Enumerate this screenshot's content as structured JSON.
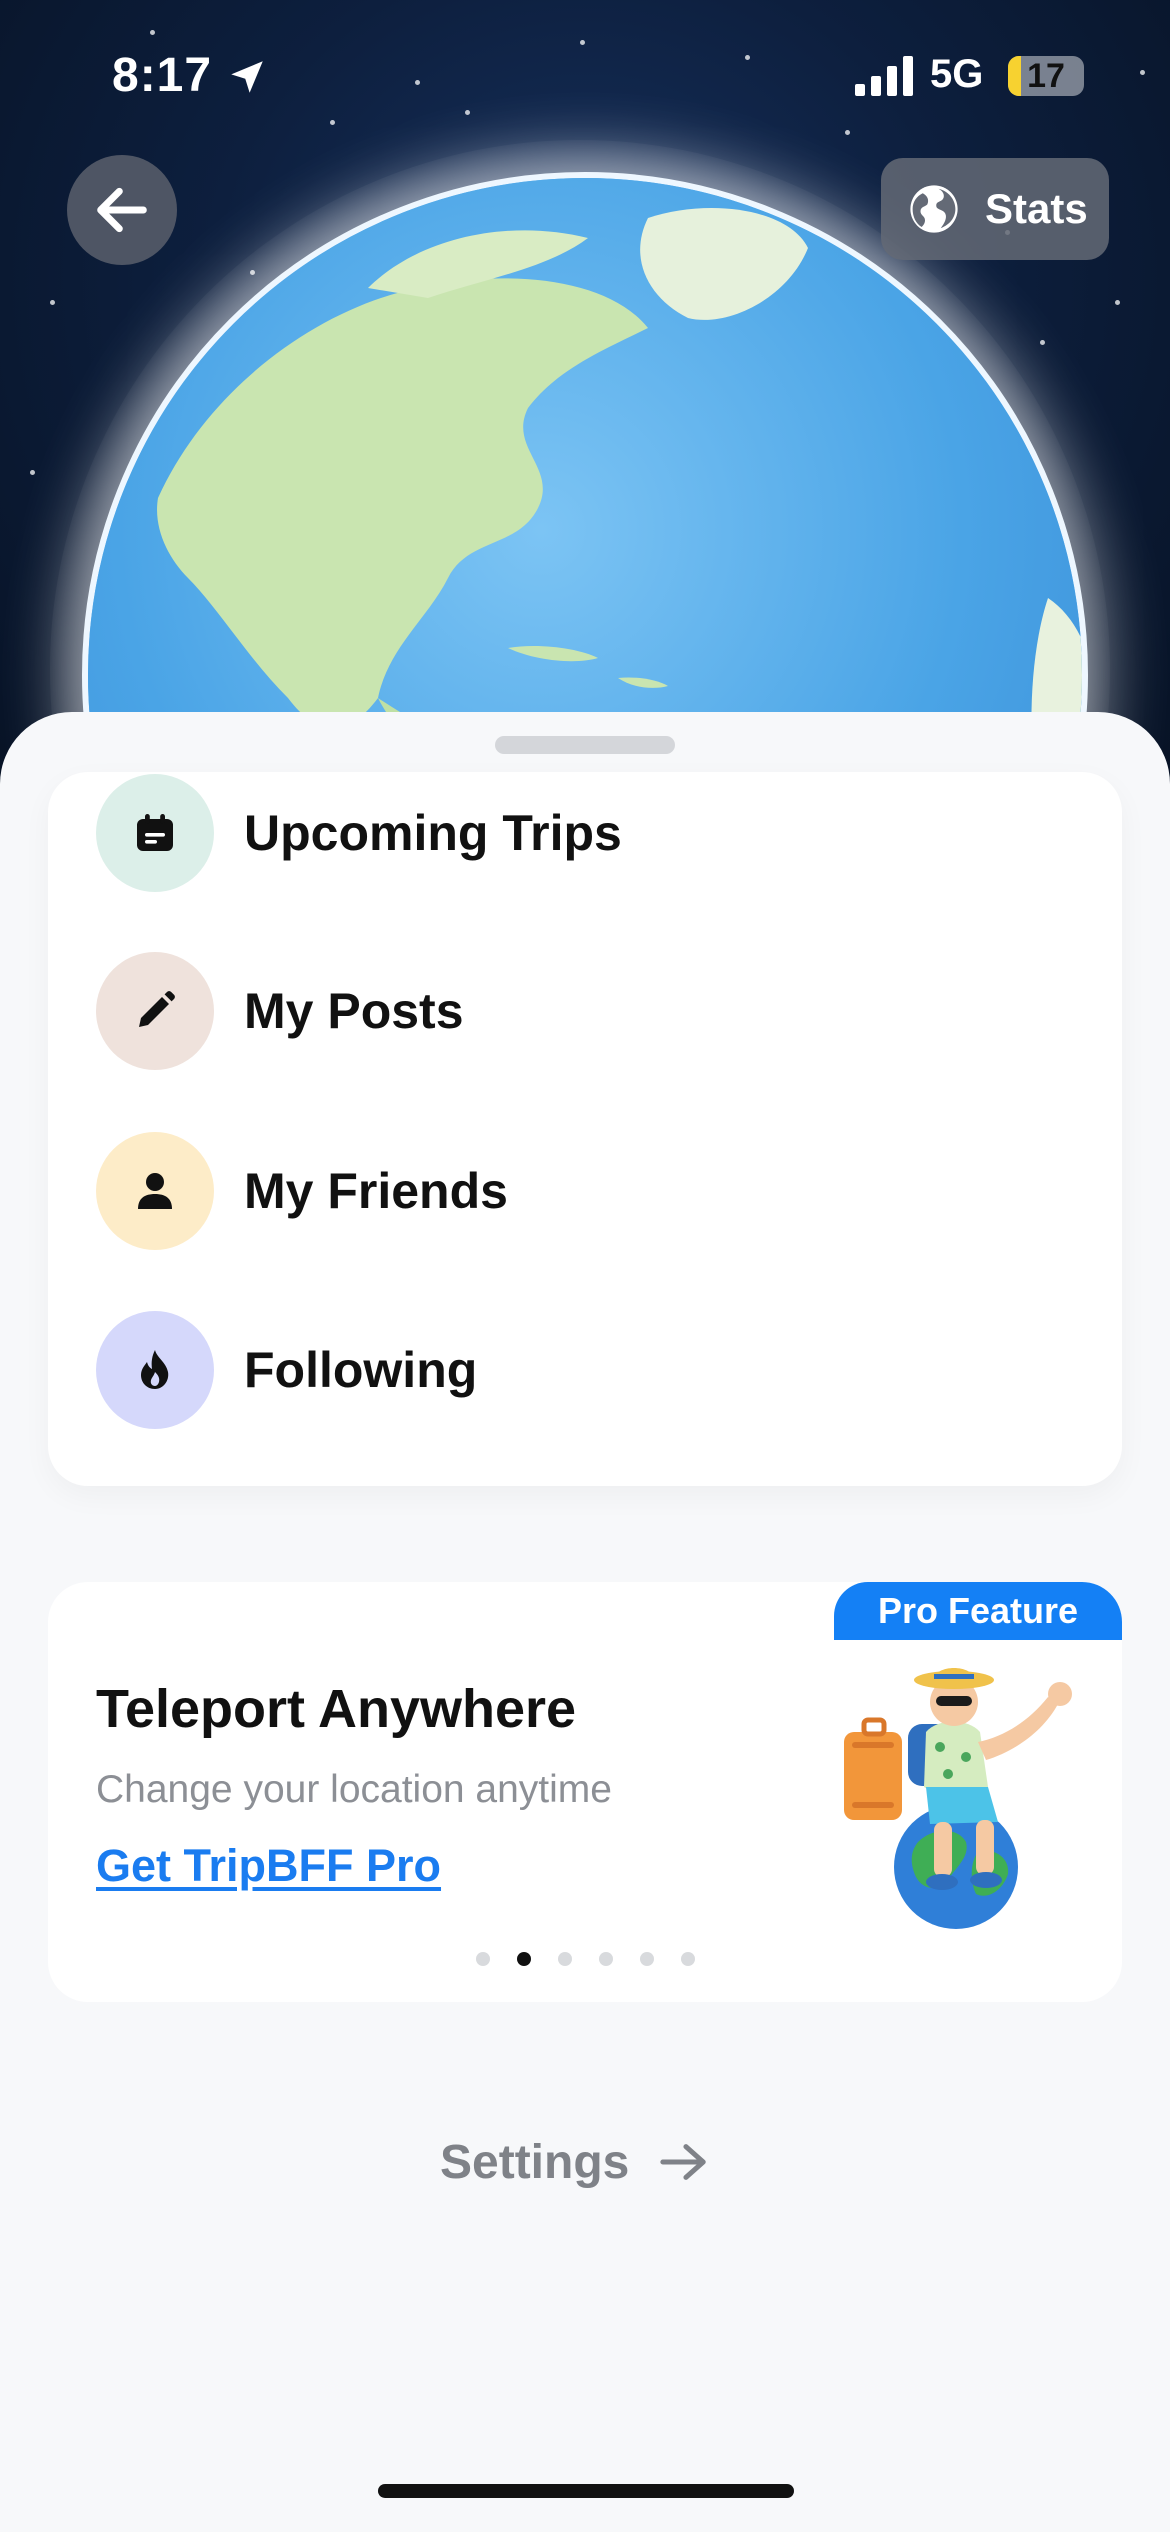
{
  "status_bar": {
    "time": "8:17",
    "network": "5G",
    "battery": "17",
    "battery_level_percent": 17
  },
  "header": {
    "back_icon": "arrow-left-icon",
    "stats_label": "Stats",
    "stats_icon": "globe-icon"
  },
  "menu": {
    "items": [
      {
        "label": "Upcoming Trips",
        "icon": "calendar-icon",
        "icon_bg": "#dcefe9"
      },
      {
        "label": "My Posts",
        "icon": "pencil-icon",
        "icon_bg": "#efe2dc"
      },
      {
        "label": "My Friends",
        "icon": "person-icon",
        "icon_bg": "#fdecc8"
      },
      {
        "label": "Following",
        "icon": "flame-icon",
        "icon_bg": "#d5d8fb"
      }
    ]
  },
  "promo": {
    "badge": "Pro Feature",
    "title": "Teleport Anywhere",
    "subtitle": "Change your location anytime",
    "link": "Get TripBFF Pro",
    "illustration": "traveler-on-globe-illustration",
    "carousel_pages": 6,
    "carousel_active_index": 1
  },
  "settings": {
    "label": "Settings",
    "icon": "arrow-right-icon"
  },
  "colors": {
    "accent_blue": "#1480f5",
    "link_blue": "#1a7cf0",
    "space_dark": "#0d1f3e",
    "ocean": "#5fb1ec"
  }
}
